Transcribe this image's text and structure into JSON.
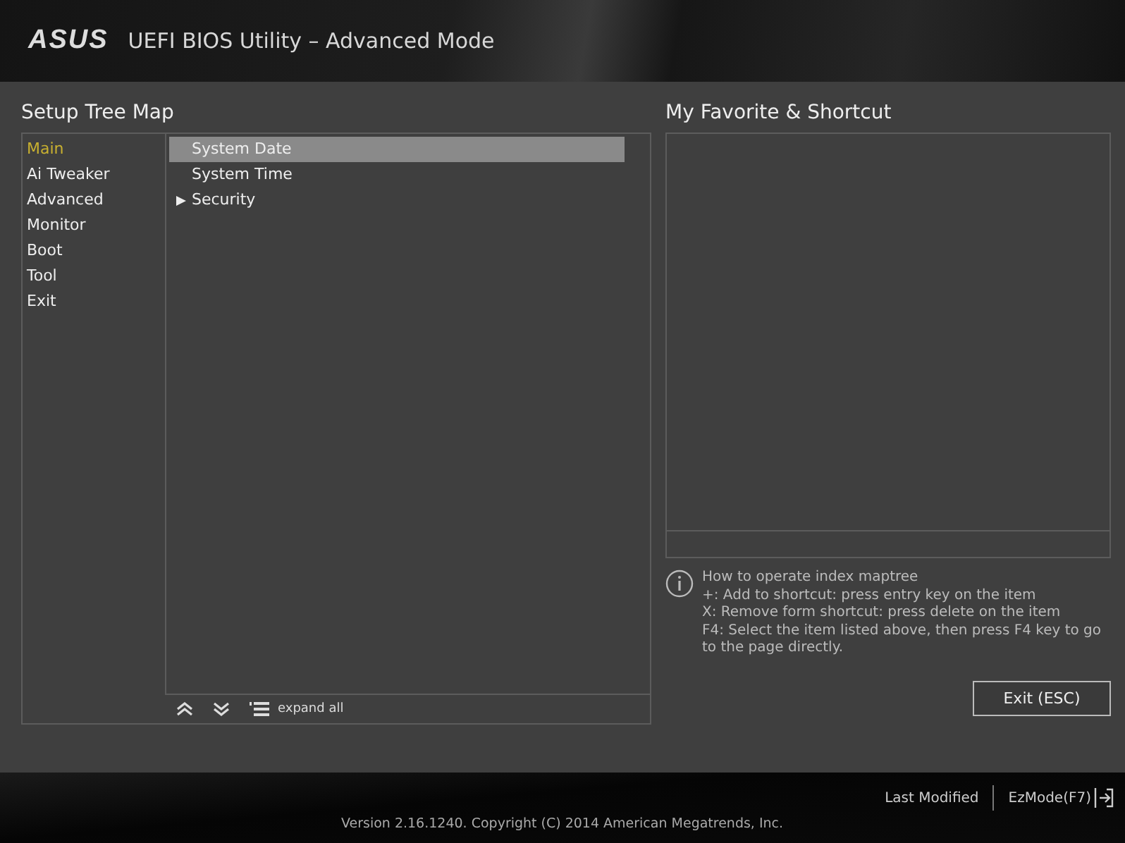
{
  "header": {
    "logo": "ASUS",
    "title": "UEFI BIOS Utility – Advanced Mode"
  },
  "tree_map": {
    "title": "Setup Tree Map",
    "menus": [
      {
        "label": "Main",
        "selected": true
      },
      {
        "label": "Ai Tweaker",
        "selected": false
      },
      {
        "label": "Advanced",
        "selected": false
      },
      {
        "label": "Monitor",
        "selected": false
      },
      {
        "label": "Boot",
        "selected": false
      },
      {
        "label": "Tool",
        "selected": false
      },
      {
        "label": "Exit",
        "selected": false
      }
    ],
    "items": [
      {
        "label": "System Date",
        "selected": true,
        "expandable": false
      },
      {
        "label": "System Time",
        "selected": false,
        "expandable": false
      },
      {
        "label": "Security",
        "selected": false,
        "expandable": true
      }
    ],
    "expand_all": "expand all"
  },
  "favorites": {
    "title": "My Favorite & Shortcut",
    "help": [
      "How to operate index maptree",
      "+: Add to shortcut: press entry key on the item",
      "X: Remove form shortcut: press delete on the item",
      "F4: Select the item listed above, then press F4 key to go to the page directly."
    ],
    "exit_button": "Exit (ESC)"
  },
  "footer": {
    "last_modified": "Last Modified",
    "ez_mode": "EzMode(F7)",
    "version": "Version 2.16.1240. Copyright (C) 2014 American Megatrends, Inc."
  }
}
